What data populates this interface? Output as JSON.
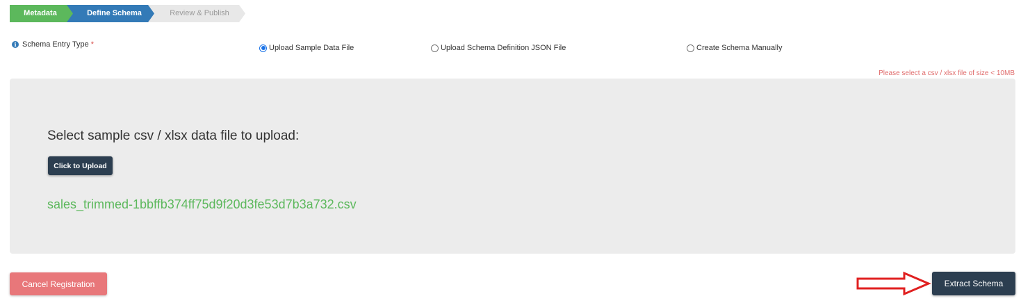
{
  "stepper": {
    "steps": [
      {
        "label": "Metadata",
        "state": "done",
        "color": "#5cb85c"
      },
      {
        "label": "Define Schema",
        "state": "active",
        "color": "#337ab7"
      },
      {
        "label": "Review & Publish",
        "state": "pending",
        "color": "#e8e8e8"
      }
    ]
  },
  "schema_entry": {
    "label": "Schema Entry Type",
    "required_mark": "*",
    "info_icon": "info-icon",
    "options": [
      {
        "label": "Upload Sample Data File",
        "selected": true
      },
      {
        "label": "Upload Schema Definition JSON File",
        "selected": false
      },
      {
        "label": "Create Schema Manually",
        "selected": false
      }
    ],
    "size_hint": "Please select a csv / xlsx file of size < 10MB"
  },
  "upload": {
    "title": "Select sample csv / xlsx data file to upload:",
    "button_label": "Click to Upload",
    "file_name": "sales_trimmed-1bbffb374ff75d9f20d3fe53d7b3a732.csv"
  },
  "footer": {
    "cancel_label": "Cancel Registration",
    "extract_label": "Extract Schema",
    "arrow_icon": "red-arrow-right-icon"
  },
  "colors": {
    "success": "#5cb85c",
    "primary": "#337ab7",
    "dark": "#2c3e50",
    "danger": "#e8777a",
    "annotation_arrow": "#e02020"
  }
}
